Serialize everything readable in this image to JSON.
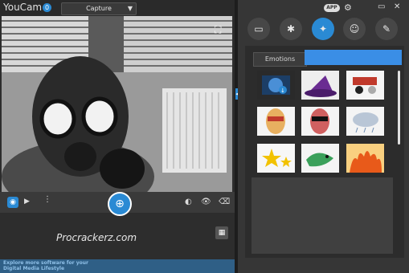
{
  "app": {
    "title": "YouCam",
    "notification_count": "0",
    "app_badge": "APP"
  },
  "capture_mode": {
    "selected": "Capture"
  },
  "window_controls": {
    "minimize": "▭",
    "close": "✕"
  },
  "preview_toolbar": {
    "layout_icon": "⛶"
  },
  "bottom_bar": {
    "watermark": "Procrackerz.com",
    "footer_text": "Explore more software for your Digital Media Lifestyle"
  },
  "effects_panel": {
    "tabs": [
      "frame",
      "effects",
      "magic",
      "avatar",
      "draw"
    ],
    "category": "Emotions",
    "thumbnails": [
      "download-more",
      "witch-hat",
      "pirate",
      "mask-face",
      "devil-face",
      "cloud",
      "stars",
      "dragon",
      "fire"
    ]
  },
  "colors": {
    "accent": "#3a8ee6",
    "capture_button": "#2a8ad4",
    "footer": "#2f5f86"
  }
}
